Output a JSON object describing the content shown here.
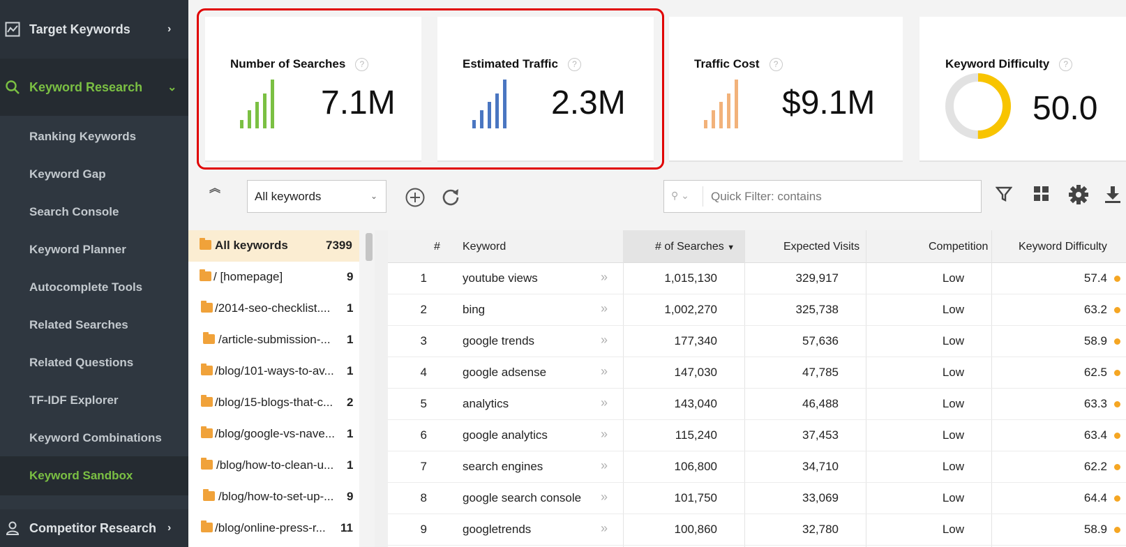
{
  "sidebar": {
    "target_keywords": "Target Keywords",
    "keyword_research": "Keyword Research",
    "sub_items": [
      "Ranking Keywords",
      "Keyword Gap",
      "Search Console",
      "Keyword Planner",
      "Autocomplete Tools",
      "Related Searches",
      "Related Questions",
      "TF-IDF Explorer",
      "Keyword Combinations",
      "Keyword Sandbox"
    ],
    "competitor_research": "Competitor Research",
    "active_item": "Keyword Sandbox"
  },
  "cards": {
    "searches": {
      "title": "Number of Searches",
      "value": "7.1M",
      "color": "#7bc043",
      "icon": "bar-signal-icon"
    },
    "traffic": {
      "title": "Estimated Traffic",
      "value": "2.3M",
      "color": "#4a76c1",
      "icon": "bar-signal-icon"
    },
    "cost": {
      "title": "Traffic Cost",
      "value": "$9.1M",
      "color": "#f2b27a",
      "icon": "bar-signal-icon"
    },
    "difficulty": {
      "title": "Keyword Difficulty",
      "value": "50.0",
      "color": "#f8c400",
      "gauge_fraction": 0.5
    }
  },
  "toolbar": {
    "group_select": "All keywords",
    "quick_filter_placeholder": "Quick Filter: contains",
    "icons": [
      "collapse-icon",
      "add-icon",
      "refresh-icon",
      "search-icon",
      "filter-icon",
      "grid-icon",
      "settings-icon",
      "download-icon"
    ]
  },
  "tree": [
    {
      "name": "All keywords",
      "count": "7399"
    },
    {
      "name": "/ [homepage]",
      "count": "9"
    },
    {
      "name": "/2014-seo-checklist....",
      "count": "1"
    },
    {
      "name": "/article-submission-...",
      "count": "1"
    },
    {
      "name": "/blog/101-ways-to-av...",
      "count": "1"
    },
    {
      "name": "/blog/15-blogs-that-c...",
      "count": "2"
    },
    {
      "name": "/blog/google-vs-nave...",
      "count": "1"
    },
    {
      "name": "/blog/how-to-clean-u...",
      "count": "1"
    },
    {
      "name": "/blog/how-to-set-up-...",
      "count": "9"
    },
    {
      "name": "/blog/online-press-r...",
      "count": "11"
    }
  ],
  "table": {
    "headers": {
      "num": "#",
      "keyword": "Keyword",
      "searches": "# of Searches",
      "visits": "Expected Visits",
      "competition": "Competition",
      "difficulty": "Keyword Difficulty"
    },
    "rows": [
      {
        "num": "1",
        "keyword": "youtube views",
        "searches": "1,015,130",
        "visits": "329,917",
        "competition": "Low",
        "difficulty": "57.4"
      },
      {
        "num": "2",
        "keyword": "bing",
        "searches": "1,002,270",
        "visits": "325,738",
        "competition": "Low",
        "difficulty": "63.2"
      },
      {
        "num": "3",
        "keyword": "google trends",
        "searches": "177,340",
        "visits": "57,636",
        "competition": "Low",
        "difficulty": "58.9"
      },
      {
        "num": "4",
        "keyword": "google adsense",
        "searches": "147,030",
        "visits": "47,785",
        "competition": "Low",
        "difficulty": "62.5"
      },
      {
        "num": "5",
        "keyword": "analytics",
        "searches": "143,040",
        "visits": "46,488",
        "competition": "Low",
        "difficulty": "63.3"
      },
      {
        "num": "6",
        "keyword": "google analytics",
        "searches": "115,240",
        "visits": "37,453",
        "competition": "Low",
        "difficulty": "63.4"
      },
      {
        "num": "7",
        "keyword": "search engines",
        "searches": "106,800",
        "visits": "34,710",
        "competition": "Low",
        "difficulty": "62.2"
      },
      {
        "num": "8",
        "keyword": "google search console",
        "searches": "101,750",
        "visits": "33,069",
        "competition": "Low",
        "difficulty": "64.4"
      },
      {
        "num": "9",
        "keyword": "googletrends",
        "searches": "100,860",
        "visits": "32,780",
        "competition": "Low",
        "difficulty": "58.9"
      }
    ]
  }
}
